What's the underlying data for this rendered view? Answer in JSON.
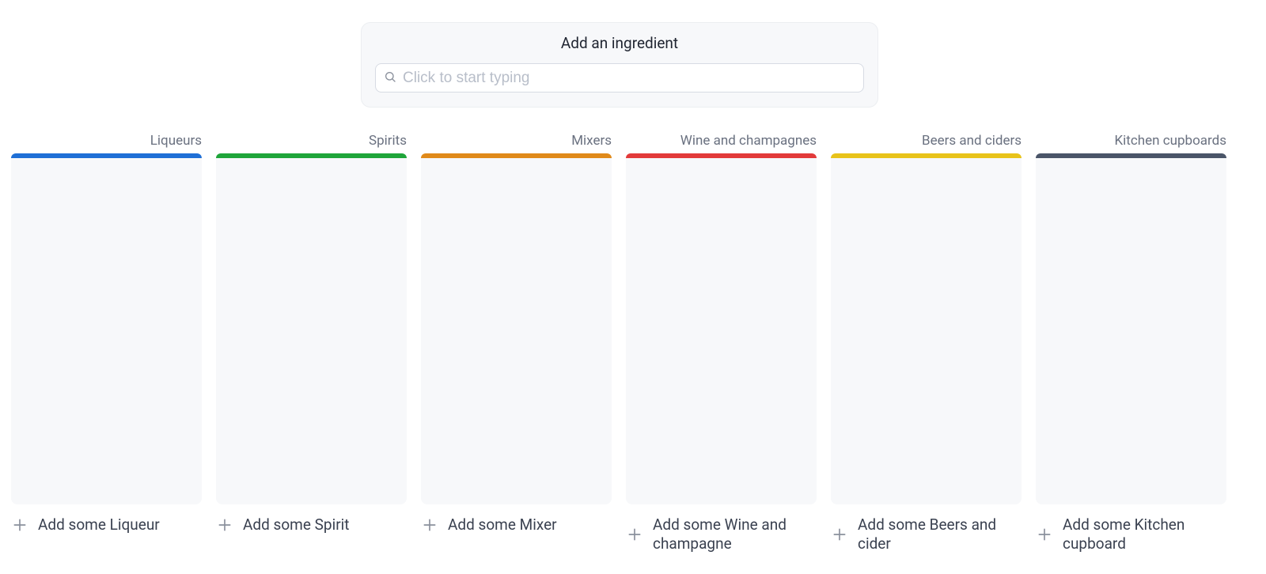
{
  "search": {
    "title": "Add an ingredient",
    "placeholder": "Click to start typing"
  },
  "columns": [
    {
      "title": "Liqueurs",
      "color": "#1f6fd6",
      "add_label": "Add some Liqueur"
    },
    {
      "title": "Spirits",
      "color": "#1fa53a",
      "add_label": "Add some Spirit"
    },
    {
      "title": "Mixers",
      "color": "#e08a1a",
      "add_label": "Add some Mixer"
    },
    {
      "title": "Wine and champagnes",
      "color": "#e23a3a",
      "add_label": "Add some Wine and champagne"
    },
    {
      "title": "Beers and ciders",
      "color": "#e8c31a",
      "add_label": "Add some Beers and cider"
    },
    {
      "title": "Kitchen cupboards",
      "color": "#4a5568",
      "add_label": "Add some Kitchen cupboard"
    }
  ]
}
